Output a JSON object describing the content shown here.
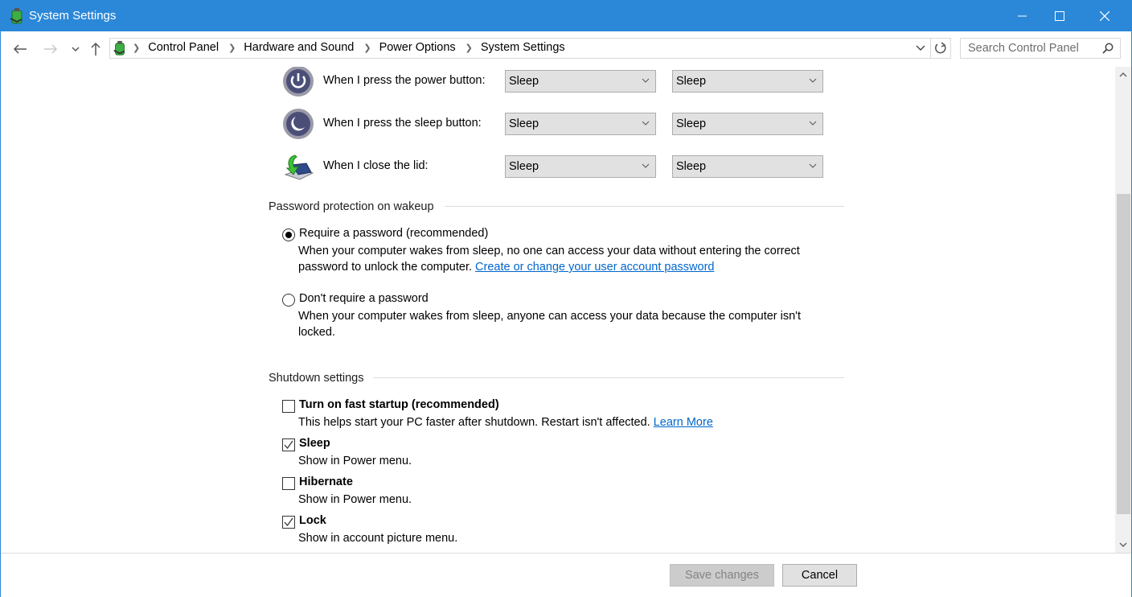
{
  "window": {
    "title": "System Settings",
    "app_icon": "power-options-battery-icon",
    "controls": {
      "minimize": "minimize-icon",
      "maximize": "maximize-icon",
      "close": "close-icon"
    },
    "accent": "#2b88d8"
  },
  "nav": {
    "back": "back-arrow-icon",
    "forward": "forward-arrow-icon",
    "recent": "chevron-down-icon",
    "up": "up-arrow-icon",
    "breadcrumbs": [
      "Control Panel",
      "Hardware and Sound",
      "Power Options",
      "System Settings"
    ],
    "search_placeholder": "Search Control Panel"
  },
  "power_buttons": {
    "rows": [
      {
        "label": "When I press the power button:",
        "icon": "power-button-icon",
        "on_battery": "Sleep",
        "plugged_in": "Sleep"
      },
      {
        "label": "When I press the sleep button:",
        "icon": "sleep-button-icon",
        "on_battery": "Sleep",
        "plugged_in": "Sleep"
      },
      {
        "label": "When I close the lid:",
        "icon": "laptop-lid-icon",
        "on_battery": "Sleep",
        "plugged_in": "Sleep"
      }
    ]
  },
  "password": {
    "title": "Password protection on wakeup",
    "options": [
      {
        "label": "Require a password (recommended)",
        "selected": true,
        "desc1": "When your computer wakes from sleep, no one can access your data without entering the correct",
        "desc2": "password to unlock the computer.",
        "link": "Create or change your user account password"
      },
      {
        "label": "Don't require a password",
        "selected": false,
        "desc1": "When your computer wakes from sleep, anyone can access your data because the computer isn't",
        "desc2": "locked."
      }
    ]
  },
  "shutdown": {
    "title": "Shutdown settings",
    "items": [
      {
        "label": "Turn on fast startup (recommended)",
        "checked": false,
        "desc": "This helps start your PC faster after shutdown. Restart isn't affected.",
        "link": "Learn More"
      },
      {
        "label": "Sleep",
        "checked": true,
        "desc": "Show in Power menu."
      },
      {
        "label": "Hibernate",
        "checked": false,
        "desc": "Show in Power menu."
      },
      {
        "label": "Lock",
        "checked": true,
        "desc": "Show in account picture menu."
      }
    ]
  },
  "footer": {
    "save_label": "Save changes",
    "save_enabled": false,
    "cancel_label": "Cancel"
  },
  "scroll": {
    "position_fraction": 1.0
  }
}
